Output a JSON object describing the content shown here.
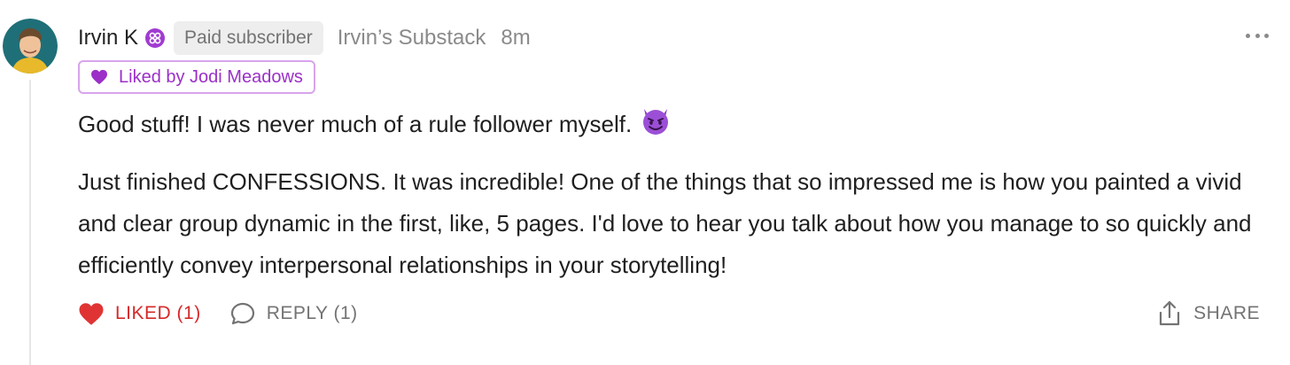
{
  "comment": {
    "author": "Irvin K",
    "badge": "Paid subscriber",
    "publication": "Irvin’s Substack",
    "time": "8m",
    "liked_by": "Liked by Jodi Meadows",
    "paragraph1": "Good stuff! I was never much of a rule follower myself.",
    "emoji": "smiling-imp",
    "paragraph2": "Just finished CONFESSIONS. It was incredible! One of the things that so impressed me is how you painted a vivid and clear group dynamic in the first, like, 5 pages. I'd love to hear you talk about how you manage to so quickly and efficiently convey interpersonal relationships in your storytelling!"
  },
  "actions": {
    "like_label": "LIKED (1)",
    "reply_label": "REPLY (1)",
    "share_label": "SHARE"
  },
  "colors": {
    "like": "#d62828",
    "liked_by": "#9b2fc8",
    "muted": "#8a8a8a"
  }
}
